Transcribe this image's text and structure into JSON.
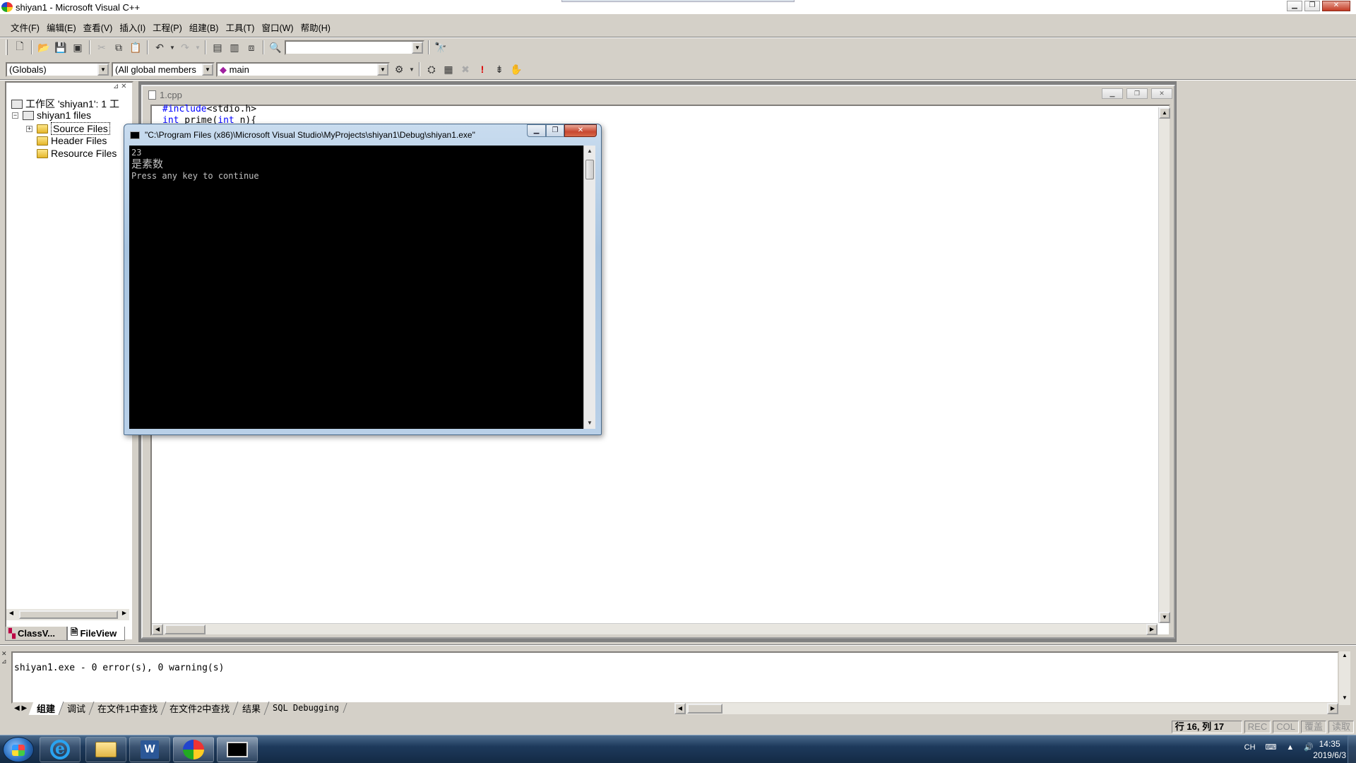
{
  "window": {
    "title": "shiyan1 - Microsoft Visual C++"
  },
  "menu": [
    "文件(F)",
    "编辑(E)",
    "查看(V)",
    "插入(I)",
    "工程(P)",
    "组建(B)",
    "工具(T)",
    "窗口(W)",
    "帮助(H)"
  ],
  "toolbar2": {
    "scope": "(Globals)",
    "members": "(All global members",
    "function": "main"
  },
  "workspace": {
    "root": "工作区 'shiyan1': 1 工",
    "project": "shiyan1 files",
    "folders": [
      "Source Files",
      "Header Files",
      "Resource Files"
    ],
    "tabs": [
      "ClassV...",
      "FileView"
    ]
  },
  "editor": {
    "tab_title": "1.cpp",
    "lines": [
      {
        "kw": "#include",
        "rest": "<stdio.h>"
      },
      {
        "kw": "int",
        "rest": " prime(",
        "kw2": "int",
        "rest2": " n){"
      }
    ]
  },
  "console": {
    "title": "\"C:\\Program Files (x86)\\Microsoft Visual Studio\\MyProjects\\shiyan1\\Debug\\shiyan1.exe\"",
    "lines": [
      "23",
      "是素数",
      "Press any key to continue"
    ]
  },
  "output": {
    "text": "shiyan1.exe - 0 error(s), 0 warning(s)",
    "tabs": [
      "组建",
      "调试",
      "在文件1中查找",
      "在文件2中查找",
      "结果",
      "SQL Debugging"
    ]
  },
  "status": {
    "position": "行 16, 列 17",
    "indicators": [
      "REC",
      "COL",
      "覆盖",
      "读取"
    ]
  },
  "taskbar": {
    "lang": "CH",
    "time": "14:35",
    "date": "2019/6/3"
  }
}
